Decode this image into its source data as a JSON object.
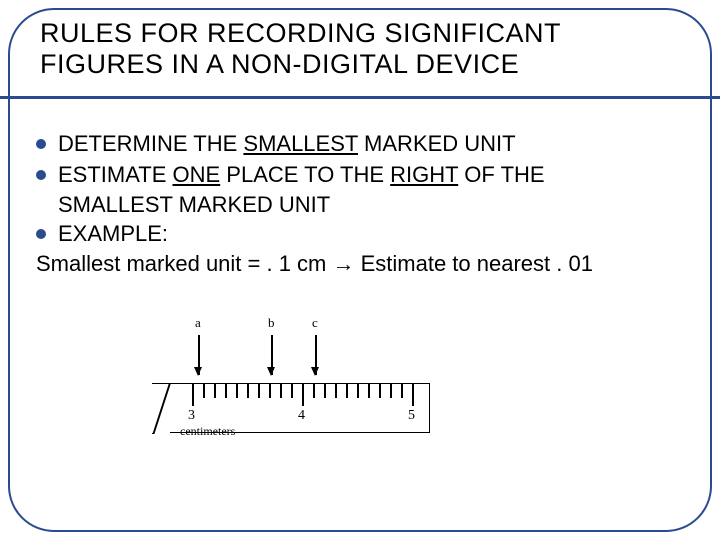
{
  "title_line1": "RULES FOR RECORDING SIGNIFICANT",
  "title_line2": "FIGURES IN A NON-DIGITAL DEVICE",
  "bullets": {
    "b1_pre": "DETERMINE THE ",
    "b1_u": "SMALLEST",
    "b1_post": " MARKED UNIT",
    "b2_pre": "ESTIMATE ",
    "b2_u1": "ONE",
    "b2_mid": " PLACE TO THE ",
    "b2_u2": "RIGHT",
    "b2_post": " OF THE",
    "b2_cont": "SMALLEST MARKED UNIT",
    "b3": "EXAMPLE:"
  },
  "example_line": "Smallest marked unit = . 1 cm → Estimate to nearest . 01",
  "pointers": {
    "a": "a",
    "b": "b",
    "c": "c"
  },
  "ruler": {
    "n3": "3",
    "n4": "4",
    "n5": "5",
    "unit": "centimeters"
  }
}
